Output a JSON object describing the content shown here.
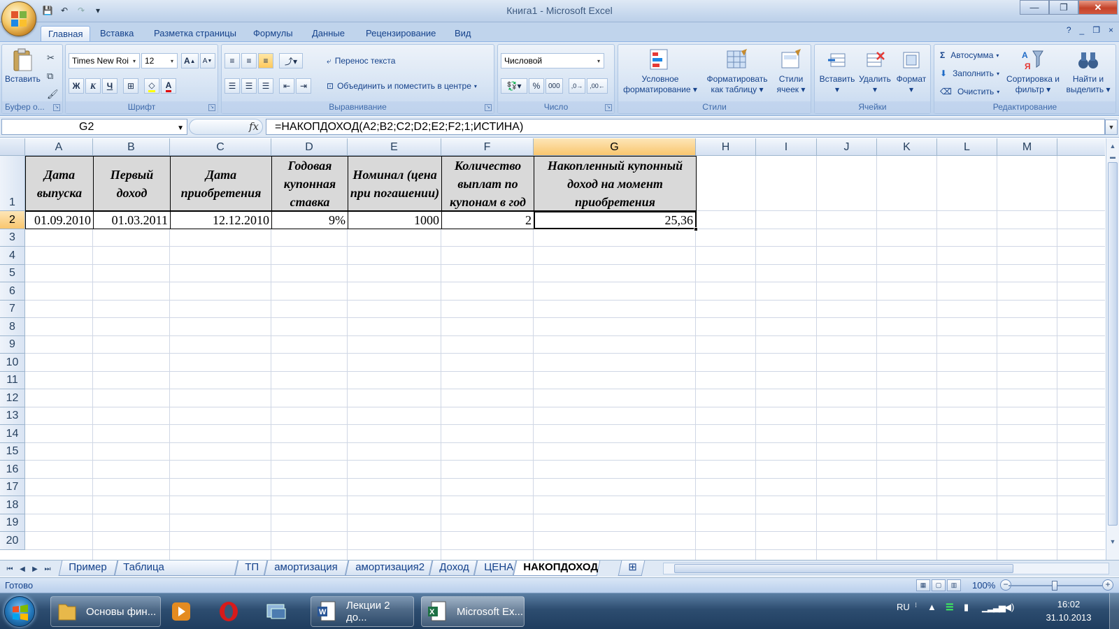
{
  "window": {
    "title": "Книга1 - Microsoft Excel",
    "controls": {
      "minimize": "—",
      "maximize": "❐",
      "close": "✕"
    }
  },
  "qat": {
    "save": "💾",
    "undo": "↶",
    "redo": "↷",
    "customize": "▾"
  },
  "ribbon_tabs": [
    "Главная",
    "Вставка",
    "Разметка страницы",
    "Формулы",
    "Данные",
    "Рецензирование",
    "Вид"
  ],
  "active_tab": "Главная",
  "ribbon": {
    "clipboard": {
      "paste": "Вставить",
      "label": "Буфер о..."
    },
    "font": {
      "name": "Times New Roi",
      "size": "12",
      "grow": "A",
      "shrink": "A",
      "bold": "Ж",
      "italic": "К",
      "underline": "Ч",
      "label": "Шрифт"
    },
    "alignment": {
      "wrap": "Перенос текста",
      "merge": "Объединить и поместить в центре",
      "label": "Выравнивание"
    },
    "number": {
      "format": "Числовой",
      "percent": "%",
      "thousands": "000",
      "label": "Число"
    },
    "styles": {
      "conditional": "Условное форматирование",
      "as_table": "Форматировать как таблицу",
      "cell_styles": "Стили ячеек",
      "label": "Стили"
    },
    "cells": {
      "insert": "Вставить",
      "delete": "Удалить",
      "format": "Формат",
      "label": "Ячейки"
    },
    "editing": {
      "autosum": "Автосумма",
      "fill": "Заполнить",
      "clear": "Очистить",
      "sort": "Сортировка и фильтр",
      "find": "Найти и выделить",
      "label": "Редактирование"
    }
  },
  "formula_bar": {
    "name_box": "G2",
    "fx": "fx",
    "formula": "=НАКОПДОХОД(A2;B2;C2;D2;E2;F2;1;ИСТИНА)"
  },
  "grid": {
    "columns": [
      "A",
      "B",
      "C",
      "D",
      "E",
      "F",
      "G",
      "H",
      "I",
      "J",
      "K",
      "L",
      "M"
    ],
    "selected_column": "G",
    "rows": [
      "1",
      "2",
      "3",
      "4",
      "5",
      "6",
      "7",
      "8",
      "9",
      "10",
      "11",
      "12",
      "13",
      "14",
      "15",
      "16",
      "17",
      "18",
      "19",
      "20"
    ],
    "selected_row": "2",
    "headers": [
      "Дата выпуска",
      "Первый доход",
      "Дата приобретения",
      "Годовая купонная ставка",
      "Номинал (цена при погашении)",
      "Количество выплат по купонам в год",
      "Накопленный купонный доход на момент приобретения"
    ],
    "values": [
      "01.09.2010",
      "01.03.2011",
      "12.12.2010",
      "9%",
      "1000",
      "2",
      "25,36"
    ]
  },
  "sheet_tabs": [
    "Пример",
    "Таблица подстановки",
    "ТП",
    "амортизация",
    "амортизация2",
    "Доход",
    "ЦЕНА",
    "НАКОПДОХОД"
  ],
  "active_sheet": "НАКОПДОХОД",
  "status": {
    "text": "Готово",
    "zoom": "100%"
  },
  "taskbar": {
    "items": [
      "Основы фин...",
      "Лекции 2 до...",
      "Microsoft Ex..."
    ],
    "lang": "RU",
    "time": "16:02",
    "date": "31.10.2013"
  }
}
